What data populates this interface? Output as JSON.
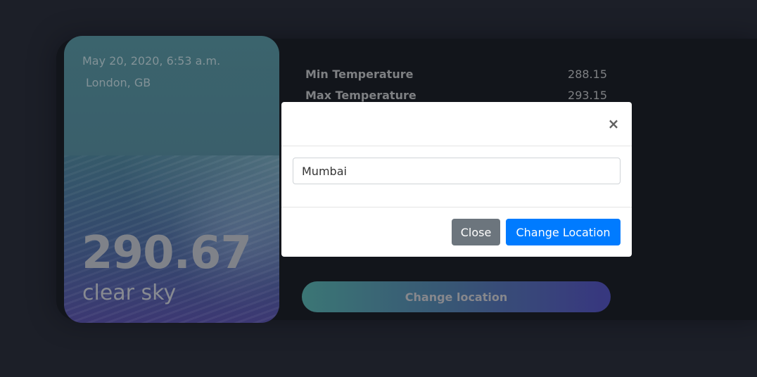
{
  "weather": {
    "date": "May 20, 2020, 6:53 a.m.",
    "location": "London, GB",
    "temperature": "290.67",
    "description": "clear sky"
  },
  "stats": [
    {
      "label": "Min Temperature",
      "value": "288.15"
    },
    {
      "label": "Max Temperature",
      "value": "293.15"
    }
  ],
  "main": {
    "change_location_label": "Change location"
  },
  "modal": {
    "close_icon": "×",
    "input_value": "Mumbai",
    "close_label": "Close",
    "submit_label": "Change Location"
  },
  "colors": {
    "primary": "#007bff",
    "secondary": "#6c757d",
    "background": "#1e212b"
  }
}
